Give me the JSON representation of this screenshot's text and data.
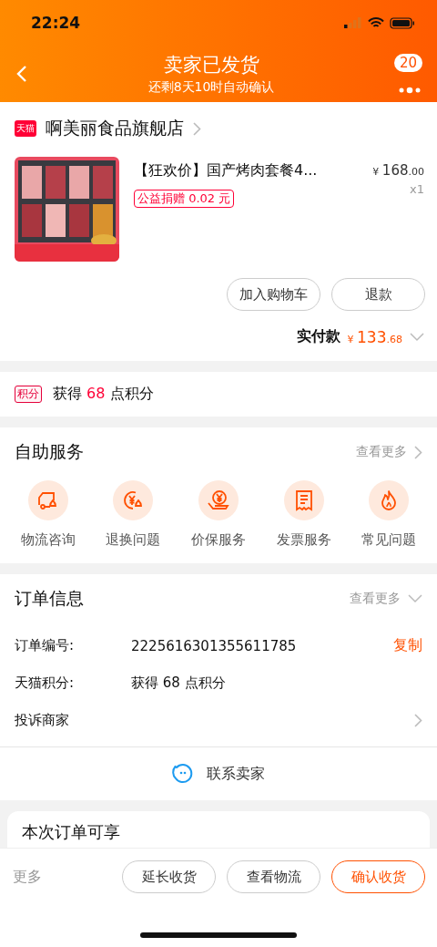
{
  "status_bar": {
    "time": "22:24"
  },
  "header": {
    "title": "卖家已发货",
    "subtitle": "还剩8天10时自动确认",
    "badge": "20"
  },
  "shop": {
    "badge": "天猫",
    "name": "啊美丽食品旗舰店"
  },
  "product": {
    "title": "【狂欢价】国产烤肉套餐4...",
    "tag": "公益捐赠 0.02 元",
    "price": {
      "currency": "¥",
      "integer": "168",
      "decimal": ".00"
    },
    "quantity": "x1"
  },
  "product_actions": [
    "加入购物车",
    "退款"
  ],
  "paid": {
    "label": "实付款",
    "currency": "¥",
    "integer": "133",
    "decimal": ".68"
  },
  "points": {
    "tag": "积分",
    "prefix": "获得",
    "amount": "68",
    "suffix": "点积分"
  },
  "self_service": {
    "title": "自助服务",
    "more": "查看更多",
    "items": [
      {
        "kind": "truck",
        "label": "物流咨询"
      },
      {
        "kind": "refund",
        "label": "退换问题"
      },
      {
        "kind": "protect",
        "label": "价保服务"
      },
      {
        "kind": "invoice",
        "label": "发票服务"
      },
      {
        "kind": "faq",
        "label": "常见问题"
      }
    ]
  },
  "order_info": {
    "title": "订单信息",
    "more": "查看更多",
    "rows": [
      {
        "kind": "copy",
        "label": "订单编号:",
        "value": "2225616301355611785",
        "action": "复制"
      },
      {
        "kind": "plain",
        "label": "天猫积分:",
        "value": "获得 68 点积分"
      },
      {
        "kind": "link",
        "label": "投诉商家"
      }
    ],
    "contact": "联系卖家"
  },
  "card": {
    "title": "本次订单可享"
  },
  "bottom_bar": {
    "more": "更多",
    "buttons": [
      {
        "label": "延长收货",
        "primary": false
      },
      {
        "label": "查看物流",
        "primary": false
      },
      {
        "label": "确认收货",
        "primary": true
      }
    ]
  }
}
